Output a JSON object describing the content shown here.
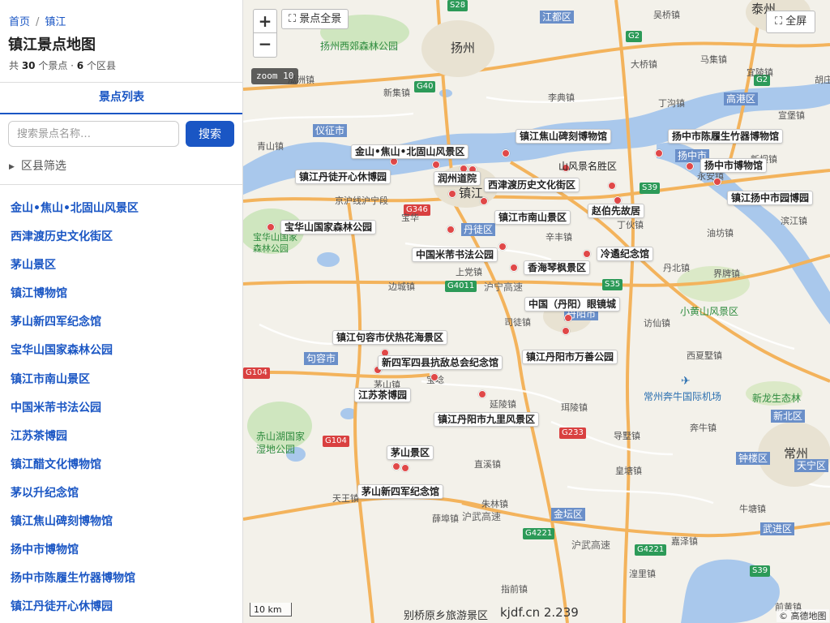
{
  "sidebar": {
    "breadcrumb": {
      "home": "首页",
      "sep": "/",
      "current": "镇江"
    },
    "title": "镇江景点地图",
    "summary": {
      "prefix": "共 ",
      "spots": "30",
      "mid": " 个景点 · ",
      "districts": "6",
      "suffix": " 个区县"
    },
    "tab": "景点列表",
    "search": {
      "placeholder": "搜索景点名称…",
      "value": "",
      "button": "搜索"
    },
    "filter": "区县筛选",
    "items": [
      "金山•焦山•北固山风景区",
      "西津渡历史文化街区",
      "茅山景区",
      "镇江博物馆",
      "茅山新四军纪念馆",
      "宝华山国家森林公园",
      "镇江市南山景区",
      "中国米芾书法公园",
      "江苏茶博园",
      "镇江醋文化博物馆",
      "茅以升纪念馆",
      "镇江焦山碑刻博物馆",
      "扬中市博物馆",
      "扬中市陈履生竹器博物馆",
      "镇江丹徒开心休博园"
    ]
  },
  "map": {
    "zoom_in": "+",
    "zoom_out": "−",
    "fit_all": "景点全景",
    "fullscreen": "全屏",
    "zoom_badge": "zoom 10",
    "scale": "10 km",
    "attribution": "© 高德地图",
    "watermark": "kjdf.cn 2.239",
    "colors": {
      "water": "#a9c8ec",
      "land": "#f3f1ea",
      "green": "#cfe6bf",
      "road_major": "#f3b35c",
      "road_minor": "#ffffff",
      "marker": "#e04848",
      "accent": "#1a56c4"
    },
    "poi_labels": [
      "镇江焦山碑刻博物馆",
      "扬中市陈履生竹器博物馆",
      "金山•焦山•北固山风景区",
      "山风景名胜区",
      "扬中市博物馆",
      "镇江丹徒开心休博园",
      "润州道院",
      "西津渡历史文化街区",
      "镇江扬中市园博园",
      "赵伯先故居",
      "镇江市南山景区",
      "宝华山国家森林公园",
      "中国米芾书法公园",
      "冷遹纪念馆",
      "香海琴枫景区",
      "中国（丹阳）眼镜城",
      "镇江句容市伏热花海景区",
      "镇江丹阳市万善公园",
      "新四军四县抗敌总会纪念馆",
      "江苏茶博园",
      "镇江丹阳市九里风景区",
      "茅山景区",
      "茅山新四军纪念馆"
    ],
    "district_labels": [
      "江都区",
      "仪征市",
      "丹徒区",
      "句容市",
      "丹阳市",
      "金坛区",
      "扬中市",
      "高港区",
      "新北区",
      "钟楼区",
      "天宁区",
      "武进区",
      "镇江"
    ],
    "city_labels": [
      "扬州",
      "泰州",
      "常州"
    ],
    "green_labels": [
      "扬州西郊森林公园",
      "宝华山国家森林公园",
      "赤山湖国家湿地公园",
      "小黄山风景区",
      "新龙生态林",
      "别桥原乡旅游景区",
      "常州奔牛国际机场"
    ],
    "road_badges": [
      "G40",
      "G2",
      "G2",
      "G346",
      "S39",
      "G4011",
      "S35",
      "G104",
      "G104",
      "G233",
      "G4221",
      "G4221",
      "S39",
      "S28"
    ],
    "road_names": [
      "沪宁高速",
      "沪武高速",
      "沪武高速",
      "京沪线沪宁段"
    ],
    "town_labels": [
      "瓜洲镇",
      "新集镇",
      "李典镇",
      "大桥镇",
      "丁沟镇",
      "马集镇",
      "青山镇",
      "宜陵镇",
      "胡庄",
      "宣堡镇",
      "新坝镇",
      "永安镇",
      "丁伙镇",
      "宝华",
      "辛丰镇",
      "上党镇",
      "边城镇",
      "丹北镇",
      "界牌镇",
      "油坊镇",
      "滨江镇",
      "司徒镇",
      "访仙镇",
      "西夏墅镇",
      "延陵镇",
      "珥陵镇",
      "导墅镇",
      "茅山镇",
      "奔牛镇",
      "直溪镇",
      "皇塘镇",
      "朱林镇",
      "薛埠镇",
      "牛塘镇",
      "指前镇",
      "嘉泽镇",
      "湟里镇",
      "天王镇",
      "前黄镇",
      "宝埝",
      "吴桥镇"
    ]
  }
}
